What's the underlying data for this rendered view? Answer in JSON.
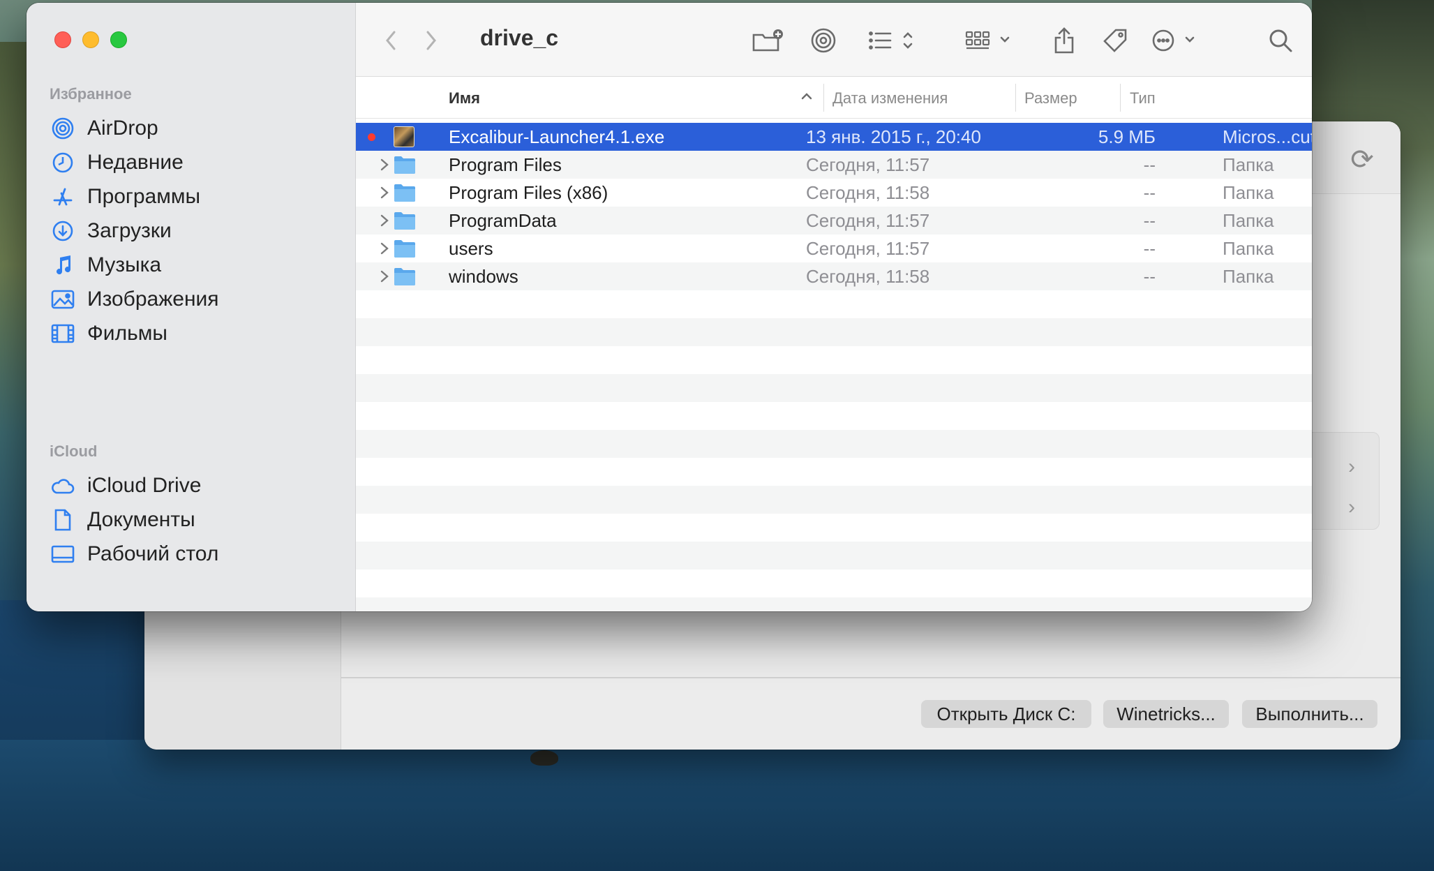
{
  "finder": {
    "title": "drive_c",
    "sidebar": {
      "favorites_label": "Избранное",
      "favorites": [
        {
          "label": "AirDrop",
          "icon": "airdrop-icon"
        },
        {
          "label": "Недавние",
          "icon": "clock-icon"
        },
        {
          "label": "Программы",
          "icon": "apps-icon"
        },
        {
          "label": "Загрузки",
          "icon": "download-icon"
        },
        {
          "label": "Музыка",
          "icon": "music-note-icon"
        },
        {
          "label": "Изображения",
          "icon": "photo-icon"
        },
        {
          "label": "Фильмы",
          "icon": "film-icon"
        }
      ],
      "icloud_label": "iCloud",
      "icloud": [
        {
          "label": "iCloud Drive",
          "icon": "cloud-icon"
        },
        {
          "label": "Документы",
          "icon": "document-icon"
        },
        {
          "label": "Рабочий стол",
          "icon": "desktop-icon"
        }
      ]
    },
    "columns": {
      "name": "Имя",
      "date": "Дата изменения",
      "size": "Размер",
      "kind": "Тип"
    },
    "rows": [
      {
        "name": "Excalibur-Launcher4.1.exe",
        "date": "13 янв. 2015 г., 20:40",
        "size": "5.9 МБ",
        "kind": "Micros...cutable",
        "selected": true,
        "tag_color": "#ff3b30"
      },
      {
        "name": "Program Files",
        "date": "Сегодня, 11:57",
        "size": "--",
        "kind": "Папка"
      },
      {
        "name": "Program Files (x86)",
        "date": "Сегодня, 11:58",
        "size": "--",
        "kind": "Папка"
      },
      {
        "name": "ProgramData",
        "date": "Сегодня, 11:57",
        "size": "--",
        "kind": "Папка"
      },
      {
        "name": "users",
        "date": "Сегодня, 11:57",
        "size": "--",
        "kind": "Папка"
      },
      {
        "name": "windows",
        "date": "Сегодня, 11:58",
        "size": "--",
        "kind": "Папка"
      }
    ]
  },
  "wine": {
    "open_drive_label": "Открыть Диск C:",
    "winetricks_label": "Winetricks...",
    "run_label": "Выполнить..."
  },
  "colors": {
    "selection": "#2b5fd9",
    "accent": "#2f7ff0",
    "folder": "#6fb7f0"
  }
}
